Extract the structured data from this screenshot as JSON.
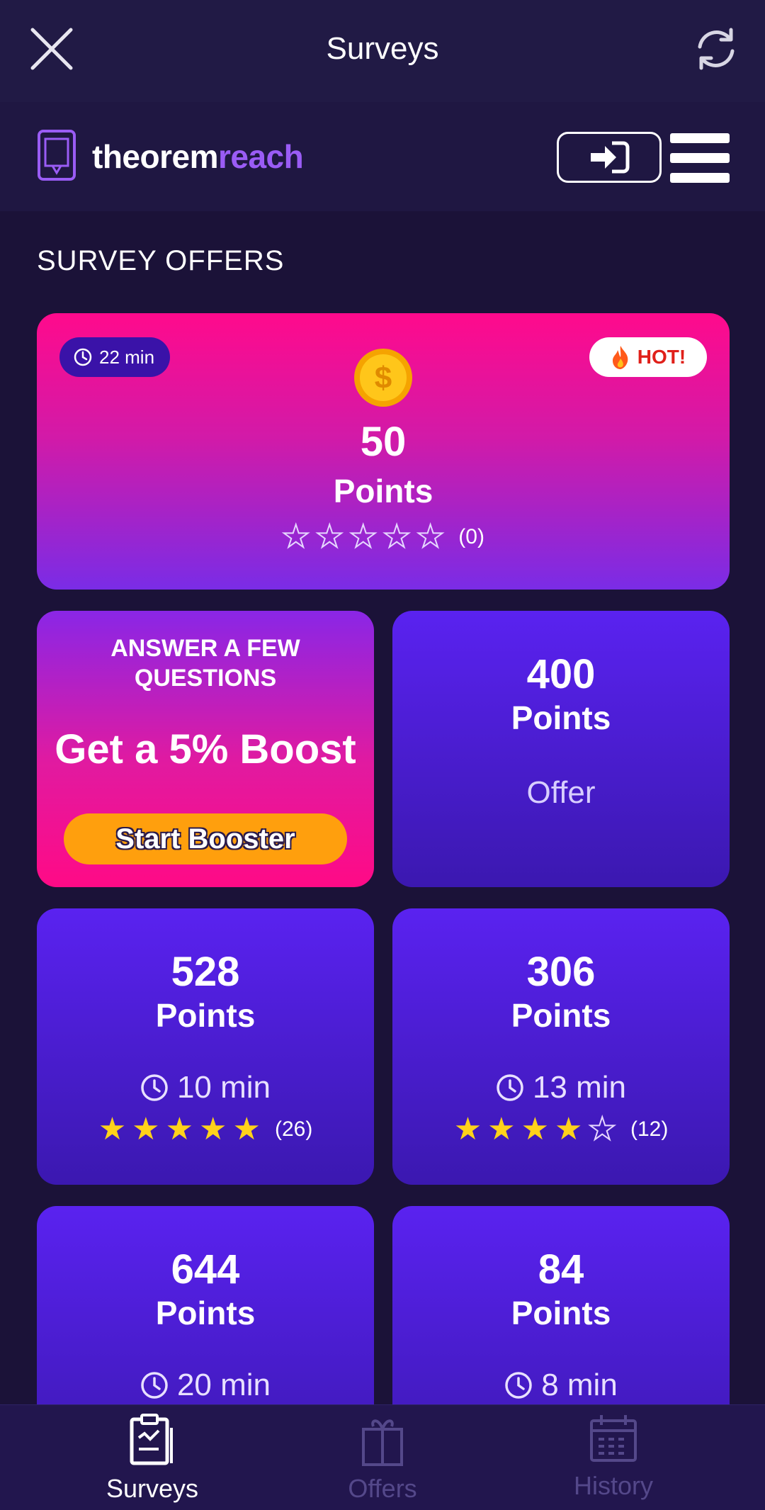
{
  "topbar": {
    "title": "Surveys"
  },
  "brand": {
    "name_part1": "theorem",
    "name_part2": "reach"
  },
  "section_title": "SURVEY OFFERS",
  "hot_card": {
    "time": "22 min",
    "hot_label": "HOT!",
    "points": "50",
    "points_label": "Points",
    "rating_count": "(0)",
    "rating": 0
  },
  "boost_card": {
    "top_text": "ANSWER A FEW QUESTIONS",
    "main_text": "Get a 5% Boost",
    "button_label": "Start Booster"
  },
  "offer_card": {
    "points": "400",
    "points_label": "Points",
    "type_label": "Offer"
  },
  "surveys": [
    {
      "points": "528",
      "points_label": "Points",
      "time": "10 min",
      "rating": 5,
      "rating_count": "(26)"
    },
    {
      "points": "306",
      "points_label": "Points",
      "time": "13 min",
      "rating": 4,
      "rating_count": "(12)"
    },
    {
      "points": "644",
      "points_label": "Points",
      "time": "20 min"
    },
    {
      "points": "84",
      "points_label": "Points",
      "time": "8 min"
    }
  ],
  "nav": [
    {
      "label": "Surveys",
      "icon": "clipboard-icon",
      "active": true
    },
    {
      "label": "Offers",
      "icon": "gift-icon",
      "active": false
    },
    {
      "label": "History",
      "icon": "calendar-icon",
      "active": false
    }
  ],
  "colors": {
    "background": "#1b1238",
    "accent_purple": "#9a5cf5",
    "hot_pink": "#ff0a8c",
    "star": "#ffd21a",
    "booster_orange": "#ff9f0d"
  }
}
